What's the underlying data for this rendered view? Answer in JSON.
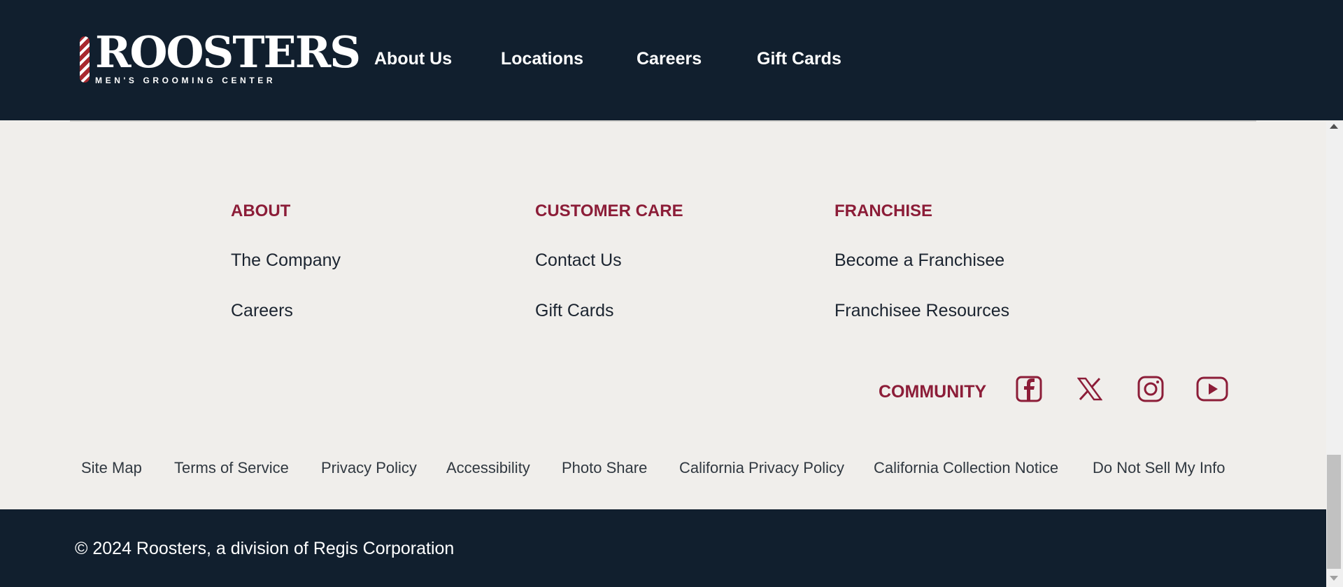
{
  "header": {
    "logo": {
      "word": "ROOSTERS",
      "tagline": "MEN'S GROOMING CENTER"
    },
    "nav": [
      {
        "label": "About Us"
      },
      {
        "label": "Locations"
      },
      {
        "label": "Careers"
      },
      {
        "label": "Gift Cards"
      }
    ]
  },
  "footer": {
    "columns": [
      {
        "heading": "ABOUT",
        "links": [
          "The Company",
          "Careers"
        ]
      },
      {
        "heading": "CUSTOMER CARE",
        "links": [
          "Contact Us",
          "Gift Cards"
        ]
      },
      {
        "heading": "FRANCHISE",
        "links": [
          "Become a Franchisee",
          "Franchisee Resources"
        ]
      }
    ],
    "community": {
      "label": "COMMUNITY",
      "icons": [
        "facebook-icon",
        "x-icon",
        "instagram-icon",
        "youtube-icon"
      ]
    },
    "legal_links": [
      "Site Map",
      "Terms of Service",
      "Privacy Policy",
      "Accessibility",
      "Photo Share",
      "California Privacy Policy",
      "California Collection Notice",
      "Do Not Sell My Info"
    ],
    "copyright": "© 2024 Roosters, a division of Regis Corporation"
  },
  "colors": {
    "header_bg": "#111f2e",
    "footer_bg": "#f0eeeb",
    "accent": "#8c1d38",
    "text": "#1b2430"
  }
}
